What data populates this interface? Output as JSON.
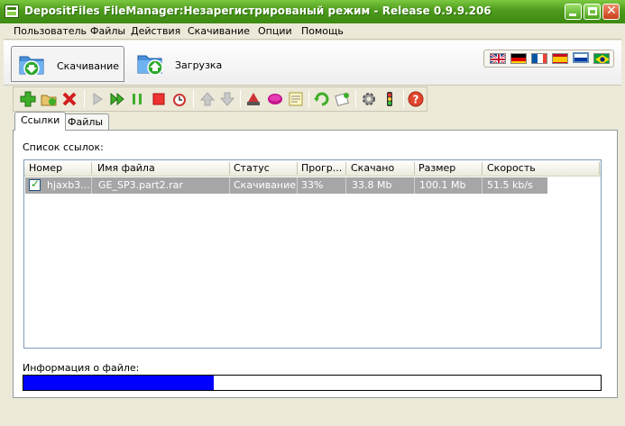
{
  "window": {
    "title": "DepositFiles FileManager:Незарегистрированый режим - Release 0.9.9.206",
    "accent": "#4d9a1c"
  },
  "menu": [
    "Пользователь",
    "Файлы",
    "Действия",
    "Скачивание",
    "Опции",
    "Помощь"
  ],
  "modes": {
    "download": "Скачивание",
    "upload": "Загрузка"
  },
  "languages": [
    "english-flag",
    "german-flag",
    "french-flag",
    "spanish-flag",
    "russian-flag",
    "brazilian-flag"
  ],
  "toolbar_icons": [
    "add-icon",
    "add-folder-icon",
    "delete-icon",
    "play-icon",
    "play-all-icon",
    "pause-icon",
    "stop-icon",
    "schedule-icon",
    "move-up-icon",
    "move-down-icon",
    "clean-icon",
    "disk-icon",
    "notes-icon",
    "refresh-icon",
    "check-icon",
    "settings-icon",
    "traffic-light-icon",
    "help-icon"
  ],
  "tabs": [
    "Ссылки",
    "Файлы"
  ],
  "links": {
    "label": "Список ссылок:",
    "columns": [
      "Номер",
      "Имя файла",
      "Статус",
      "Прогр...",
      "Скачано",
      "Размер",
      "Скорость"
    ],
    "rows": [
      {
        "number": "hjaxb3...",
        "filename": "GE_SP3.part2.rar",
        "status": "Скачивание",
        "progress": "33%",
        "downloaded": "33.8 Mb",
        "size": "100.1 Mb",
        "speed": "51.5 kb/s"
      }
    ]
  },
  "file_info": {
    "label": "Информация о файле:",
    "progress": 0.33
  }
}
